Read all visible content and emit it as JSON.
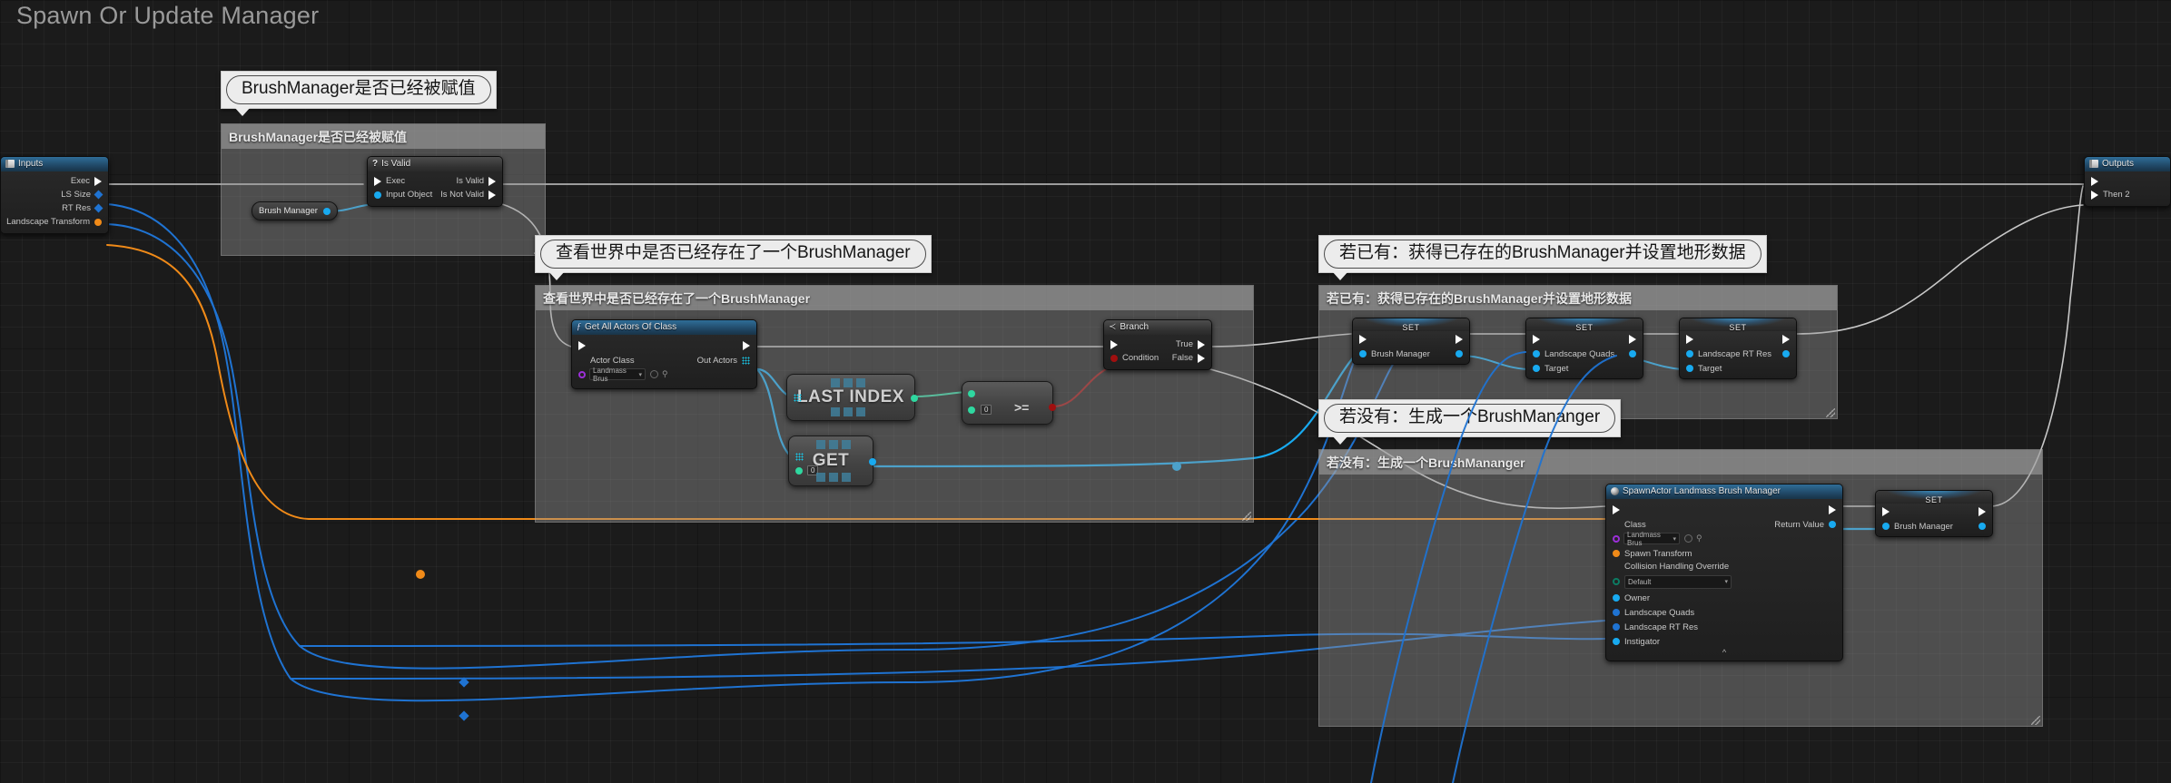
{
  "graph": {
    "title": "Spawn Or Update Manager",
    "background_color": "#1b1b1b",
    "grid_color": "#2a2a2a"
  },
  "colors": {
    "exec_white": "#ffffff",
    "object_blue": "#18aaf0",
    "struct_orange": "#f08a18",
    "int_green": "#2fd8a0",
    "bool_red": "#a00f0f",
    "class_purple": "#9b2fd8",
    "array_cyan": "#18c7e8",
    "wire_blue": "#1f73d2",
    "node_header_blue": "#2f6d98"
  },
  "bubbles": [
    {
      "id": "bubble-assigned",
      "text": "BrushManager是否已经被赋值"
    },
    {
      "id": "bubble-exists",
      "text": "查看世界中是否已经存在了一个BrushManager"
    },
    {
      "id": "bubble-has",
      "text": "若已有：获得已存在的BrushManager并设置地形数据"
    },
    {
      "id": "bubble-none",
      "text": "若没有：生成一个BrushMananger"
    }
  ],
  "comments": [
    {
      "id": "comment-assigned",
      "title": "BrushManager是否已经被赋值"
    },
    {
      "id": "comment-exists",
      "title": "查看世界中是否已经存在了一个BrushManager"
    },
    {
      "id": "comment-has",
      "title": "若已有：获得已存在的BrushManager并设置地形数据"
    },
    {
      "id": "comment-none",
      "title": "若没有：生成一个BrushMananger"
    }
  ],
  "nodes": {
    "inputs": {
      "title": "Inputs",
      "icon": "io-panel-icon",
      "pins": [
        {
          "label": "Exec",
          "type": "exec"
        },
        {
          "label": "LS Size",
          "type": "int"
        },
        {
          "label": "RT Res",
          "type": "int"
        },
        {
          "label": "Landscape Transform",
          "type": "struct"
        }
      ]
    },
    "outputs": {
      "title": "Outputs",
      "icon": "io-panel-icon",
      "pins": [
        {
          "label": "",
          "type": "exec"
        },
        {
          "label": "Then 2",
          "type": "exec"
        }
      ]
    },
    "brush_manager_var": {
      "label": "Brush Manager"
    },
    "is_valid": {
      "title": "Is Valid",
      "icon": "question-icon",
      "inputs": [
        {
          "label": "Exec",
          "type": "exec"
        },
        {
          "label": "Input Object",
          "type": "object"
        }
      ],
      "outputs": [
        {
          "label": "Is Valid",
          "type": "exec"
        },
        {
          "label": "Is Not Valid",
          "type": "exec"
        }
      ]
    },
    "get_all_actors": {
      "title": "Get All Actors Of Class",
      "icon": "function-icon",
      "input_pin_label": "Actor Class",
      "output_pin_label": "Out Actors",
      "class_value": "Landmass Brus",
      "widget_icons": [
        "reset-icon",
        "browse-search-icon"
      ]
    },
    "last_index": {
      "label": "LAST INDEX"
    },
    "array_get": {
      "label": "GET",
      "index_value": "0"
    },
    "greater_equal": {
      "label": ">=",
      "operand_value": "0"
    },
    "branch": {
      "title": "Branch",
      "icon": "branch-icon",
      "inputs": [
        {
          "label": "",
          "type": "exec"
        },
        {
          "label": "Condition",
          "type": "bool"
        }
      ],
      "outputs": [
        {
          "label": "True",
          "type": "exec"
        },
        {
          "label": "False",
          "type": "exec"
        }
      ]
    },
    "set_brush_manager_a": {
      "title": "SET",
      "pin_label": "Brush Manager"
    },
    "set_landscape_quads": {
      "title": "SET",
      "pin_label": "Landscape Quads",
      "target_label": "Target"
    },
    "set_landscape_rt_res": {
      "title": "SET",
      "pin_label": "Landscape RT Res",
      "target_label": "Target"
    },
    "spawn_actor": {
      "title": "SpawnActor Landmass Brush Manager",
      "icon": "actor-sphere-icon",
      "class_label": "Class",
      "class_value": "Landmass Brus",
      "return_label": "Return Value",
      "pins": [
        {
          "label": "Spawn Transform",
          "type": "struct"
        },
        {
          "label": "Owner",
          "type": "object-ring"
        },
        {
          "label": "Landscape Quads",
          "type": "int"
        },
        {
          "label": "Landscape RT Res",
          "type": "int"
        },
        {
          "label": "Instigator",
          "type": "object-ring"
        }
      ],
      "collision_label": "Collision Handling Override",
      "collision_value": "Default",
      "collapse_icon": "chevron-up-icon"
    },
    "set_brush_manager_b": {
      "title": "SET",
      "pin_label": "Brush Manager"
    }
  }
}
